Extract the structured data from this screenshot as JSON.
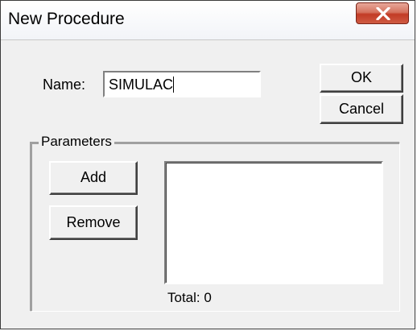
{
  "window": {
    "title": "New Procedure",
    "close_icon": "close-x-icon"
  },
  "form": {
    "name_label": "Name:",
    "name_value": "SIMULAC",
    "ok_label": "OK",
    "cancel_label": "Cancel"
  },
  "parameters": {
    "group_label": "Parameters",
    "add_label": "Add",
    "remove_label": "Remove",
    "items": [],
    "total_label": "Total:",
    "total_value": "0"
  },
  "colors": {
    "close_button": "#c23b25",
    "dialog_background": "#f0f0f0"
  }
}
